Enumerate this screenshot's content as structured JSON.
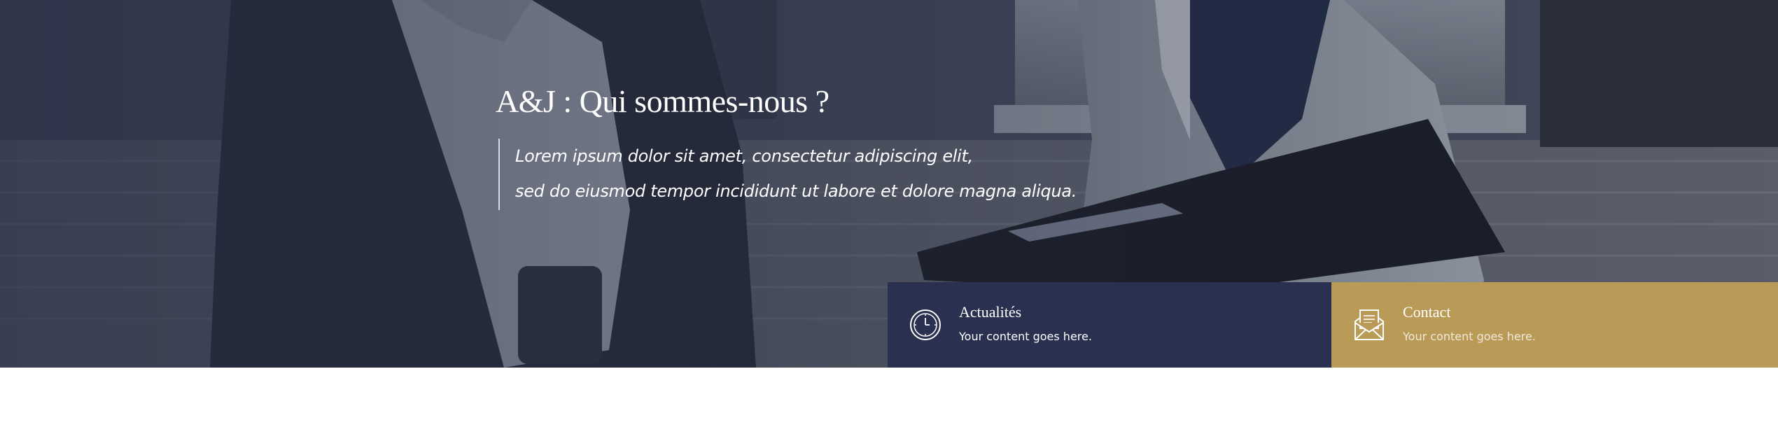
{
  "hero": {
    "title": "A&J : Qui sommes-nous ?",
    "quote_line1": "Lorem ipsum dolor sit amet, consectetur adipiscing elit,",
    "quote_line2": "sed do eiusmod tempor incididunt ut labore et dolore magna aliqua."
  },
  "cards": {
    "news": {
      "title": "Actualités",
      "text": "Your content goes here.",
      "icon": "clock-icon",
      "color": "#2a3150"
    },
    "contact": {
      "title": "Contact",
      "text": "Your content goes here.",
      "icon": "envelope-letter-icon",
      "color": "#b99a56"
    }
  }
}
